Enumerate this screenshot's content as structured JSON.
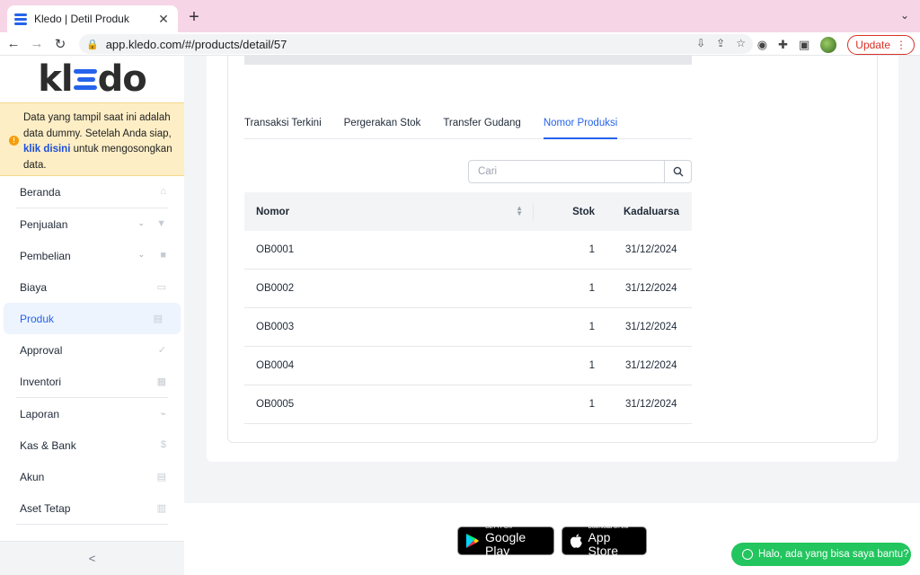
{
  "browser": {
    "tab_title": "Kledo | Detil Produk",
    "tab_close": "✕",
    "new_tab": "+",
    "url": "app.kledo.com/#/products/detail/57",
    "update_label": "Update"
  },
  "sidebar": {
    "logo_left": "kl",
    "logo_right": "do",
    "notice": {
      "text_before": "Data yang tampil saat ini adalah data dummy. Setelah Anda siap, ",
      "link": "klik disini",
      "text_after": " untuk mengosongkan data."
    },
    "items": [
      {
        "label": "Beranda",
        "icon": "home-icon"
      },
      {
        "label": "Penjualan",
        "icon": "basket-icon",
        "expandable": true
      },
      {
        "label": "Pembelian",
        "icon": "bag-icon",
        "expandable": true
      },
      {
        "label": "Biaya",
        "icon": "card-icon"
      },
      {
        "label": "Produk",
        "icon": "box-icon",
        "active": true
      },
      {
        "label": "Approval",
        "icon": "check-icon"
      },
      {
        "label": "Inventori",
        "icon": "warehouse-icon"
      },
      {
        "label": "Laporan",
        "icon": "chart-icon"
      },
      {
        "label": "Kas & Bank",
        "icon": "dollar-icon"
      },
      {
        "label": "Akun",
        "icon": "ledger-icon"
      },
      {
        "label": "Aset Tetap",
        "icon": "building-icon"
      }
    ],
    "collapse": "<"
  },
  "tabs": [
    "Transaksi Terkini",
    "Pergerakan Stok",
    "Transfer Gudang",
    "Nomor Produksi"
  ],
  "active_tab": 3,
  "search": {
    "placeholder": "Cari"
  },
  "table": {
    "headers": [
      "Nomor",
      "Stok",
      "Kadaluarsa"
    ],
    "rows": [
      [
        "OB0001",
        "1",
        "31/12/2024"
      ],
      [
        "OB0002",
        "1",
        "31/12/2024"
      ],
      [
        "OB0003",
        "1",
        "31/12/2024"
      ],
      [
        "OB0004",
        "1",
        "31/12/2024"
      ],
      [
        "OB0005",
        "1",
        "31/12/2024"
      ]
    ]
  },
  "footer": {
    "google_play_small": "GET IT ON",
    "google_play_big": "Google Play",
    "app_store_small": "Download on the",
    "app_store_big": "App Store",
    "whatsapp": "Halo, ada yang bisa saya bantu?"
  },
  "colors": {
    "accent": "#2563eb",
    "notice_bg": "#fdeec5",
    "whatsapp": "#22c55e",
    "tabbar": "#f6d6e6"
  }
}
